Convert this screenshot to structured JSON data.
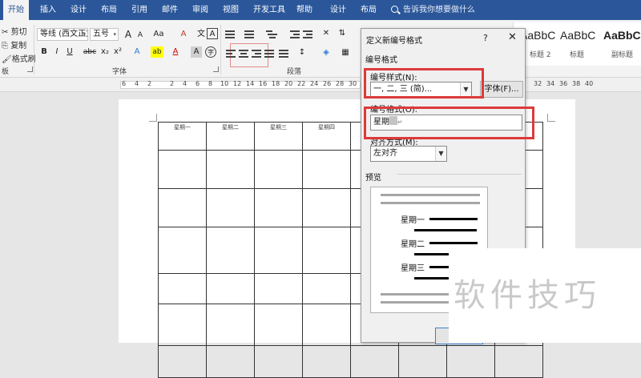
{
  "ribbon_tabs": [
    "开始",
    "插入",
    "设计",
    "布局",
    "引用",
    "邮件",
    "审阅",
    "视图",
    "开发工具",
    "帮助",
    "设计",
    "布局"
  ],
  "tell_me": "告诉我你想要做什么",
  "clipboard": {
    "cut": "剪切",
    "copy": "复制",
    "painter": "格式刷",
    "group_partial": "板"
  },
  "font": {
    "name": "等线 (西文正文)",
    "size": "五号",
    "grow_label": "A",
    "shrink_label": "A",
    "case_label": "Aa",
    "clear_label": "A",
    "border_char_label": "A",
    "bold": "B",
    "italic": "I",
    "underline": "U",
    "strike": "abc",
    "sub": "x₂",
    "sup": "x²",
    "effects": "A",
    "highlight": "ab",
    "color": "A",
    "shade": "A",
    "circle": "字",
    "group": "字体"
  },
  "paragraph": {
    "group": "段落"
  },
  "styles": [
    {
      "preview": "AaBbC",
      "name": "标题 2"
    },
    {
      "preview": "AaBbC",
      "name": "标题"
    },
    {
      "preview": "AaBbC",
      "name": "副标题"
    }
  ],
  "ruler": [
    "6",
    "4",
    "2",
    "2",
    "4",
    "6",
    "8",
    "10",
    "12",
    "14",
    "16",
    "18",
    "20",
    "22",
    "24",
    "26",
    "28",
    "30",
    "32",
    "34",
    "36",
    "38",
    "40"
  ],
  "table": {
    "headers": [
      "星期一",
      "星期二",
      "星期三",
      "星期四"
    ]
  },
  "dialog": {
    "title": "定义新编号格式",
    "help": "?",
    "close": "✕",
    "section_numbering": "编号格式",
    "style_label": "编号样式(N):",
    "style_value": "一, 二, 三 (简)...",
    "font_button": "字体(F)...",
    "format_label": "编号格式(O):",
    "format_prefix": "星期",
    "format_mark": "↵",
    "align_label": "对齐方式(M):",
    "align_value": "左对齐",
    "preview_label": "预览",
    "preview_items": [
      "星期一",
      "星期二",
      "星期三"
    ],
    "ok_partial": "确"
  },
  "colors": {
    "tabbar": "#2b579a",
    "highlight_red": "#dd3a3a",
    "preview_dark": "#000000",
    "preview_grey": "#a6a6a6"
  },
  "watermark": "软件技巧"
}
